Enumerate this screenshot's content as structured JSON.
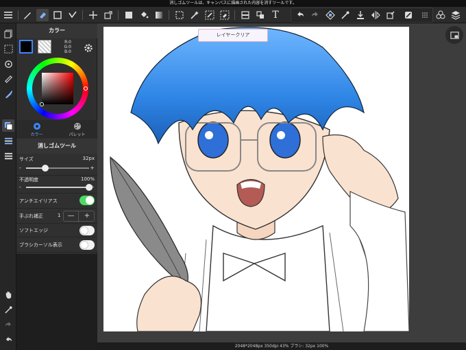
{
  "status_bar": {
    "message": "消しゴムツールは、キャンバスに描画された内容を消すツールです。"
  },
  "toolbar": {
    "left_icons": [
      "menu-icon",
      "pen-icon",
      "eraser-icon",
      "selection-rect-icon",
      "select-arrow-icon",
      "move-icon",
      "transform-icon",
      "fill-icon",
      "bucket-icon",
      "gradient-icon",
      "lasso-select-icon",
      "magic-wand-icon",
      "select-pen-icon",
      "select-eraser-icon",
      "filter-icon",
      "text-cut-icon",
      "text-icon"
    ],
    "text_tool": "T",
    "right_icons": [
      "undo-icon",
      "redo-icon",
      "paint-tool-icon",
      "dropper-icon",
      "scale-icon",
      "flip-icon",
      "canvas-icon",
      "settings-icon",
      "grid-icon"
    ]
  },
  "colors": {
    "accent": "#4cd964",
    "panel": "#2f2f2f",
    "foreground": "#000000",
    "background": "#ffffff"
  },
  "color_panel": {
    "title": "カラー",
    "rgb": {
      "r": "R:0",
      "g": "G:0",
      "b": "B:0"
    },
    "tabs": [
      {
        "label": "カラー"
      },
      {
        "label": "パレット"
      }
    ]
  },
  "tool_panel": {
    "title": "消しゴムツール",
    "size": {
      "label": "サイズ",
      "value": "32px",
      "level": 0.3
    },
    "opacity": {
      "label": "不透明度",
      "value": "100%",
      "level": 1.0
    },
    "antialias": {
      "label": "アンチエイリアス",
      "on": true
    },
    "stabilizer": {
      "label": "手ぶれ補正",
      "value": "1",
      "minus": "—",
      "plus": "+"
    },
    "soft_edge": {
      "label": "ソフトエッジ",
      "on": false
    },
    "brush_cursor": {
      "label": "ブラシカーソル表示",
      "on": false
    }
  },
  "canvas": {
    "clear_layer_button": "レイヤークリア",
    "info": "2048*2048px 350dpi 43% ブラシ: 32px 100%"
  }
}
